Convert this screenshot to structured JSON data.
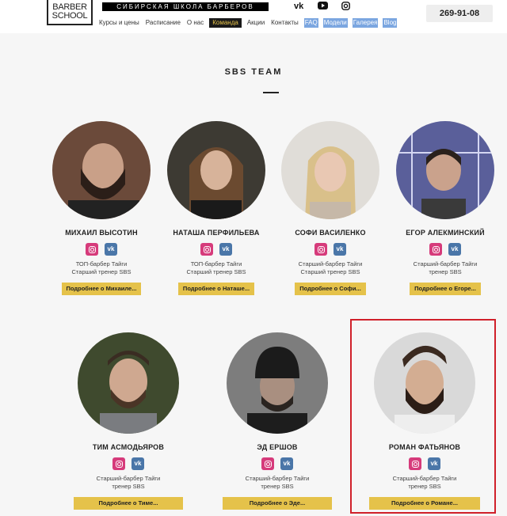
{
  "header": {
    "logo_line1": "BARBER",
    "logo_line2": "SCHOOL",
    "brand": "СИБИРСКАЯ ШКОЛА БАРБЕРОВ",
    "social": [
      "VK",
      "YouTube",
      "Instagram"
    ],
    "phone": "269-91-08"
  },
  "nav": [
    "Курсы и цены",
    "Расписание",
    "О нас",
    "Команда",
    "Акции",
    "Контакты",
    "FAQ",
    "Модели",
    "Галерея",
    "Blog"
  ],
  "nav_active": "Команда",
  "section": {
    "title": "SBS TEAM"
  },
  "team": [
    {
      "name": "МИХАИЛ ВЫСОТИН",
      "desc1": "ТОП-барбер Тайги",
      "desc2": "Старший тренер SBS",
      "more": "Подробнее о Михаиле..."
    },
    {
      "name": "НАТАША ПЕРФИЛЬЕВА",
      "desc1": "ТОП-барбер Тайги",
      "desc2": "Старший тренер SBS",
      "more": "Подробнее о Наташе..."
    },
    {
      "name": "СОФИ ВАСИЛЕНКО",
      "desc1": "Старший-барбер Тайги",
      "desc2": "Старший тренер SBS",
      "more": "Подробнее о Софи..."
    },
    {
      "name": "ЕГОР АЛЕКМИНСКИЙ",
      "desc1": "Старший-барбер Тайги",
      "desc2": "тренер SBS",
      "more": "Подробнее о Егоре..."
    },
    {
      "name": "ТИМ АСМОДЬЯРОВ",
      "desc1": "Старший-барбер Тайги",
      "desc2": "тренер SBS",
      "more": "Подробнее о Тиме..."
    },
    {
      "name": "ЭД ЕРШОВ",
      "desc1": "Старший-барбер Тайги",
      "desc2": "тренер SBS",
      "more": "Подробнее о Эде..."
    },
    {
      "name": "РОМАН ФАТЬЯНОВ",
      "desc1": "Старший-барбер Тайги",
      "desc2": "тренер SBS",
      "more": "Подробнее о Романе..."
    }
  ],
  "colors": {
    "accent": "#e5c24a",
    "instagram": "#d63b7b",
    "vk": "#4a76a8",
    "highlight": "#d0202a"
  }
}
